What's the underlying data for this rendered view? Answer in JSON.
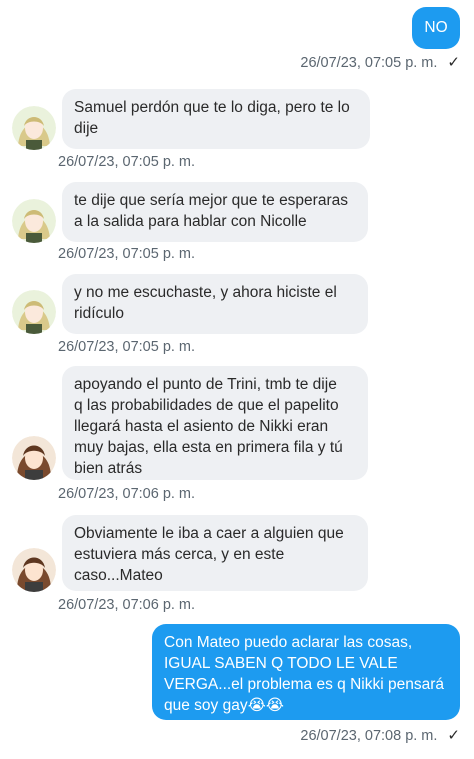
{
  "messages": [
    {
      "dir": "out",
      "lines": [
        "NO"
      ],
      "time": "26/07/23, 07:05 p. m."
    },
    {
      "dir": "in",
      "avatar": "blonde-girl-avatar",
      "lines": [
        "Samuel perdón que te lo diga, pero te lo",
        "dije"
      ],
      "time": "26/07/23, 07:05 p. m."
    },
    {
      "dir": "in",
      "avatar": "blonde-girl-avatar",
      "lines": [
        "te dije que sería mejor que te esperaras",
        "a la salida para hablar con Nicolle"
      ],
      "time": "26/07/23, 07:05 p. m."
    },
    {
      "dir": "in",
      "avatar": "blonde-girl-avatar",
      "lines": [
        "y no me escuchaste, y ahora hiciste el",
        "ridículo"
      ],
      "time": "26/07/23, 07:05 p. m."
    },
    {
      "dir": "in",
      "avatar": "brown-hair-girl-avatar",
      "lines": [
        "apoyando el punto de Trini, tmb te dije",
        "q las probabilidades de que el papelito",
        "llegará hasta el asiento de Nikki eran",
        "muy bajas, ella esta en primera fila y tú",
        "bien atrás"
      ],
      "time": "26/07/23, 07:06 p. m."
    },
    {
      "dir": "in",
      "avatar": "brown-hair-girl-avatar",
      "lines": [
        "Obviamente le iba a caer a alguien que",
        "estuviera más cerca, y en este",
        "caso...Mateo"
      ],
      "time": "26/07/23, 07:06 p. m."
    },
    {
      "dir": "out",
      "lines": [
        "Con Mateo puedo aclarar las cosas,",
        "IGUAL SABEN Q TODO LE VALE",
        "VERGA...el problema es q Nikki pensará",
        "que soy gay😭😭"
      ],
      "time": "26/07/23, 07:08 p. m."
    }
  ],
  "icons": {
    "read": "checkmark-icon"
  },
  "colors": {
    "outgoing": "#1d9bf0",
    "incoming": "#eef0f3",
    "timestamp": "#5b6670"
  }
}
